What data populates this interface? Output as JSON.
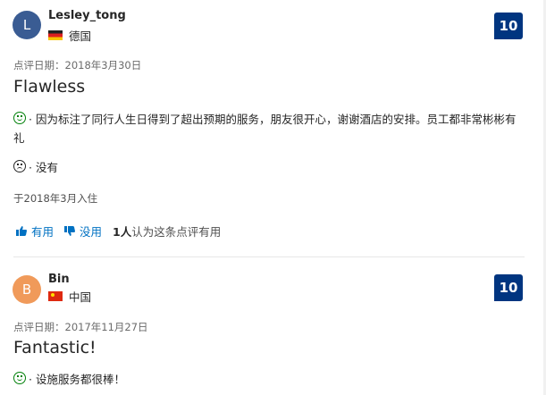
{
  "reviews": [
    {
      "avatar_letter": "L",
      "username": "Lesley_tong",
      "country": "德国",
      "score": "10",
      "date": "点评日期：2018年3月30日",
      "title": "Flawless",
      "positive": "· 因为标注了同行人生日得到了超出预期的服务，朋友很开心，谢谢酒店的安排。员工都非常彬彬有礼",
      "negative": "· 没有",
      "stay": "于2018年3月入住",
      "helpful_label": "有用",
      "unhelpful_label": "没用",
      "helpful_count_num": "1人",
      "helpful_count_text": "认为这条点评有用"
    },
    {
      "avatar_letter": "B",
      "username": "Bin",
      "country": "中国",
      "score": "10",
      "date": "点评日期：2017年11月27日",
      "title": "Fantastic!",
      "positive": "· 设施服务都很棒！"
    }
  ],
  "colors": {
    "score_bg": "#003580",
    "link": "#0071c2",
    "positive": "#008009"
  }
}
